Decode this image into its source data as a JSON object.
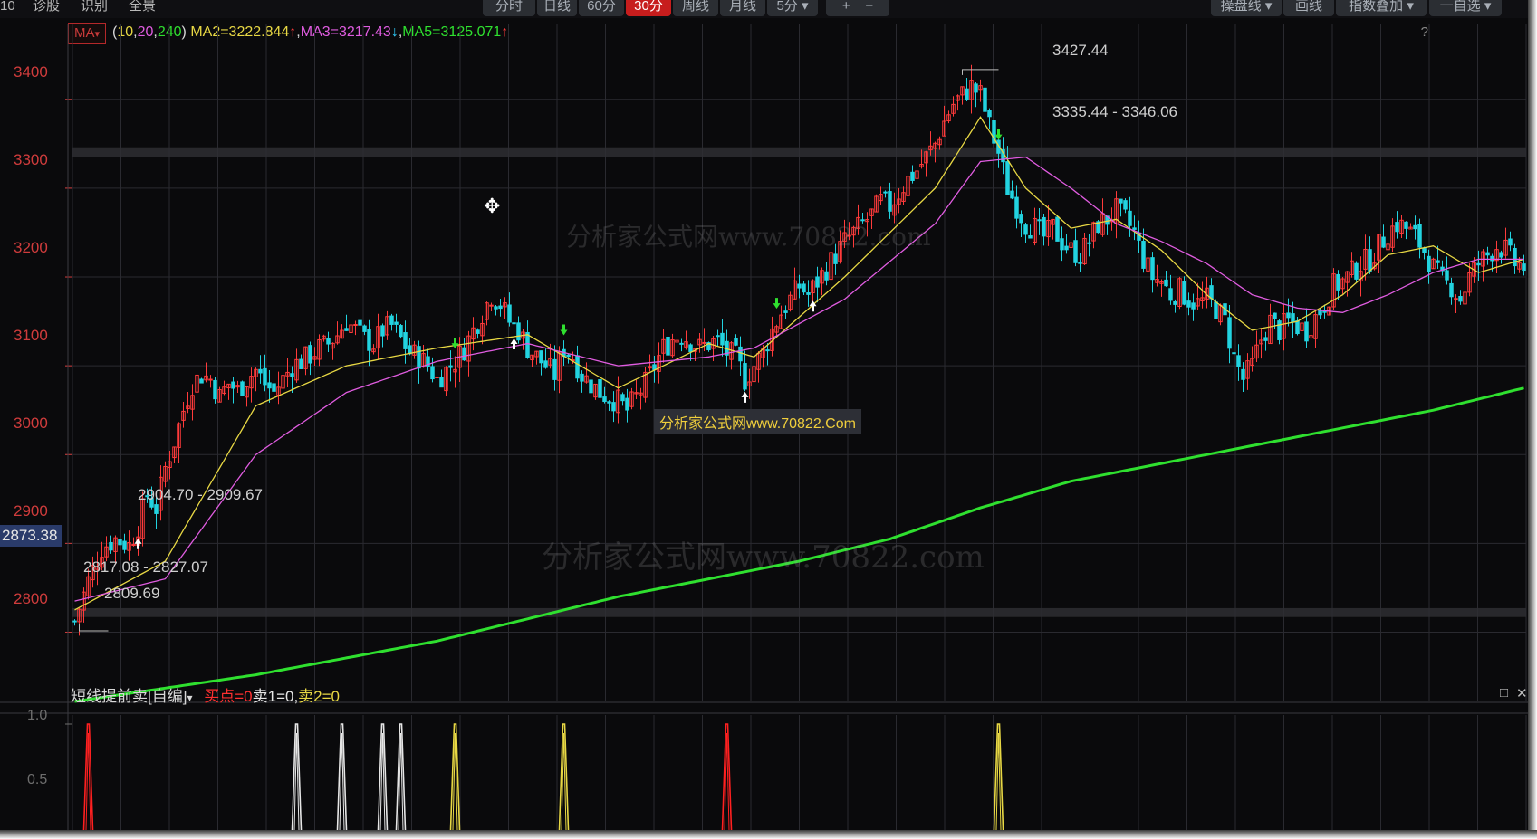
{
  "toolbar": {
    "left_items": [
      "10",
      "诊股",
      "识别",
      "全景"
    ],
    "period_tabs": [
      "分时",
      "日线",
      "60分",
      "30分",
      "周线",
      "月线",
      "5分"
    ],
    "zoom_in": "+",
    "zoom_out": "−",
    "right_items": [
      "操盘线",
      "画线",
      "指数叠加",
      "一自选"
    ]
  },
  "legend": {
    "indicator": "MA",
    "params_open": "(",
    "params": [
      "10",
      "20",
      "240"
    ],
    "params_sep": ",",
    "params_close": ")",
    "ma2": " MA2=3222.844",
    "ma2_arrow": "↑",
    "ma3": "MA3=3217.43",
    "ma3_arrow": "↓",
    "ma5": "MA5=3125.071",
    "ma5_arrow": "↑",
    "sep": ",",
    "help": "?"
  },
  "watermark": {
    "big": "分析家公式网www.70822.com",
    "small": "分析家公式网www.70822.Com"
  },
  "sub_panel": {
    "name": "短线提前卖[自编]",
    "values": [
      "买点=0",
      "卖1=0,",
      "卖2=0"
    ],
    "maximize_icon": "□",
    "close_icon": "✕"
  },
  "colors": {
    "background": "#0a0a0c",
    "up_candle": "#ff3b3b",
    "down_candle": "#22d3e0",
    "ma10": "#e8d844",
    "ma20": "#e05ce0",
    "ma240": "#2fe02f",
    "grid": "#2a2a30",
    "buy_signal": "#ff2020",
    "sell1_signal": "#e6e6e6",
    "sell2_signal": "#e8d844"
  },
  "chart_data": [
    {
      "type": "candlestick",
      "title": "",
      "y_ticks": [
        "3400",
        "3300",
        "3200",
        "3100",
        "3000",
        "2900",
        "2800"
      ],
      "ylim": [
        2722,
        3463
      ],
      "cursor_price": "2873.38",
      "annotations": [
        "3427.44",
        "3335.44 - 3346.06",
        "2904.70 - 2909.67",
        "2817.08 - 2827.07",
        "2809.69"
      ],
      "price_high": 3427.44,
      "price_low": 2809.69,
      "bands": [
        {
          "low": 3335.44,
          "high": 3346.06
        },
        {
          "low": 2817.08,
          "high": 2827.07
        }
      ],
      "close_path": [
        [
          0,
          2812
        ],
        [
          3,
          2858
        ],
        [
          6,
          2895
        ],
        [
          9,
          2905
        ],
        [
          12,
          2898
        ],
        [
          14,
          2920
        ],
        [
          16,
          2955
        ],
        [
          18,
          2940
        ],
        [
          20,
          2985
        ],
        [
          22,
          3015
        ],
        [
          24,
          3050
        ],
        [
          26,
          3080
        ],
        [
          28,
          3090
        ],
        [
          30,
          3085
        ],
        [
          32,
          3065
        ],
        [
          34,
          3080
        ],
        [
          36,
          3072
        ],
        [
          38,
          3085
        ],
        [
          40,
          3095
        ],
        [
          42,
          3080
        ],
        [
          44,
          3070
        ],
        [
          46,
          3085
        ],
        [
          48,
          3100
        ],
        [
          50,
          3105
        ],
        [
          52,
          3112
        ],
        [
          54,
          3120
        ],
        [
          56,
          3125
        ],
        [
          58,
          3135
        ],
        [
          60,
          3150
        ],
        [
          62,
          3140
        ],
        [
          64,
          3130
        ],
        [
          66,
          3125
        ],
        [
          68,
          3140
        ],
        [
          70,
          3145
        ],
        [
          72,
          3130
        ],
        [
          74,
          3115
        ],
        [
          76,
          3110
        ],
        [
          78,
          3100
        ],
        [
          80,
          3085
        ],
        [
          82,
          3095
        ],
        [
          84,
          3105
        ],
        [
          86,
          3120
        ],
        [
          88,
          3140
        ],
        [
          90,
          3160
        ],
        [
          92,
          3180
        ],
        [
          94,
          3170
        ],
        [
          96,
          3150
        ],
        [
          98,
          3140
        ],
        [
          100,
          3120
        ],
        [
          102,
          3110
        ],
        [
          104,
          3100
        ],
        [
          106,
          3090
        ],
        [
          108,
          3120
        ],
        [
          110,
          3110
        ],
        [
          112,
          3090
        ],
        [
          114,
          3080
        ],
        [
          116,
          3070
        ],
        [
          118,
          3065
        ],
        [
          120,
          3060
        ],
        [
          122,
          3050
        ],
        [
          124,
          3065
        ],
        [
          126,
          3080
        ],
        [
          128,
          3100
        ],
        [
          130,
          3120
        ],
        [
          132,
          3130
        ],
        [
          134,
          3135
        ],
        [
          136,
          3128
        ],
        [
          138,
          3120
        ],
        [
          140,
          3125
        ],
        [
          142,
          3128
        ],
        [
          144,
          3115
        ],
        [
          146,
          3110
        ],
        [
          148,
          3085
        ],
        [
          150,
          3100
        ],
        [
          152,
          3115
        ],
        [
          154,
          3140
        ],
        [
          156,
          3160
        ],
        [
          158,
          3175
        ],
        [
          160,
          3190
        ],
        [
          162,
          3180
        ],
        [
          164,
          3195
        ],
        [
          166,
          3210
        ],
        [
          168,
          3225
        ],
        [
          170,
          3240
        ],
        [
          172,
          3250
        ],
        [
          174,
          3260
        ],
        [
          176,
          3270
        ],
        [
          178,
          3285
        ],
        [
          180,
          3280
        ],
        [
          182,
          3295
        ],
        [
          184,
          3310
        ],
        [
          186,
          3320
        ],
        [
          188,
          3335
        ],
        [
          190,
          3350
        ],
        [
          192,
          3375
        ],
        [
          194,
          3395
        ],
        [
          196,
          3405
        ],
        [
          198,
          3415
        ],
        [
          200,
          3405
        ],
        [
          202,
          3370
        ],
        [
          204,
          3340
        ],
        [
          206,
          3300
        ],
        [
          208,
          3280
        ],
        [
          210,
          3260
        ],
        [
          212,
          3255
        ],
        [
          214,
          3245
        ],
        [
          216,
          3255
        ],
        [
          218,
          3240
        ],
        [
          220,
          3230
        ],
        [
          222,
          3225
        ],
        [
          224,
          3240
        ],
        [
          226,
          3260
        ],
        [
          228,
          3265
        ],
        [
          230,
          3275
        ],
        [
          232,
          3265
        ],
        [
          234,
          3250
        ],
        [
          236,
          3220
        ],
        [
          238,
          3200
        ],
        [
          240,
          3195
        ],
        [
          242,
          3180
        ],
        [
          244,
          3185
        ],
        [
          246,
          3175
        ],
        [
          248,
          3170
        ],
        [
          250,
          3175
        ],
        [
          252,
          3165
        ],
        [
          254,
          3150
        ],
        [
          256,
          3110
        ],
        [
          258,
          3085
        ],
        [
          260,
          3100
        ],
        [
          262,
          3130
        ],
        [
          264,
          3150
        ],
        [
          266,
          3140
        ],
        [
          268,
          3150
        ],
        [
          270,
          3145
        ],
        [
          272,
          3140
        ],
        [
          274,
          3155
        ],
        [
          276,
          3170
        ],
        [
          278,
          3190
        ],
        [
          280,
          3195
        ],
        [
          282,
          3205
        ],
        [
          284,
          3215
        ],
        [
          286,
          3220
        ],
        [
          288,
          3235
        ],
        [
          290,
          3250
        ],
        [
          292,
          3260
        ],
        [
          294,
          3255
        ],
        [
          296,
          3245
        ],
        [
          298,
          3230
        ],
        [
          300,
          3210
        ],
        [
          302,
          3195
        ],
        [
          304,
          3190
        ],
        [
          306,
          3175
        ],
        [
          308,
          3200
        ],
        [
          310,
          3215
        ],
        [
          312,
          3225
        ],
        [
          314,
          3235
        ],
        [
          316,
          3230
        ],
        [
          318,
          3215
        ],
        [
          320,
          3212
        ]
      ],
      "total_bars": 321,
      "x_ticks": [],
      "ma_lines": [
        {
          "name": "MA2",
          "values_path": [
            [
              0,
              2825
            ],
            [
              20,
              2880
            ],
            [
              40,
              3055
            ],
            [
              60,
              3100
            ],
            [
              80,
              3120
            ],
            [
              100,
              3135
            ],
            [
              120,
              3075
            ],
            [
              140,
              3125
            ],
            [
              150,
              3110
            ],
            [
              170,
              3200
            ],
            [
              190,
              3300
            ],
            [
              200,
              3380
            ],
            [
              210,
              3300
            ],
            [
              220,
              3255
            ],
            [
              230,
              3265
            ],
            [
              240,
              3230
            ],
            [
              250,
              3180
            ],
            [
              260,
              3140
            ],
            [
              270,
              3150
            ],
            [
              280,
              3180
            ],
            [
              290,
              3225
            ],
            [
              300,
              3235
            ],
            [
              310,
              3205
            ],
            [
              320,
              3220
            ]
          ]
        },
        {
          "name": "MA3",
          "values_path": [
            [
              0,
              2835
            ],
            [
              20,
              2860
            ],
            [
              40,
              3000
            ],
            [
              60,
              3070
            ],
            [
              80,
              3105
            ],
            [
              100,
              3125
            ],
            [
              120,
              3100
            ],
            [
              140,
              3110
            ],
            [
              150,
              3120
            ],
            [
              170,
              3175
            ],
            [
              190,
              3260
            ],
            [
              200,
              3330
            ],
            [
              210,
              3335
            ],
            [
              220,
              3300
            ],
            [
              230,
              3260
            ],
            [
              240,
              3240
            ],
            [
              250,
              3215
            ],
            [
              260,
              3180
            ],
            [
              270,
              3165
            ],
            [
              280,
              3160
            ],
            [
              290,
              3180
            ],
            [
              300,
              3205
            ],
            [
              310,
              3220
            ],
            [
              320,
              3220
            ]
          ]
        },
        {
          "name": "MA5",
          "values_path": [
            [
              0,
              2722
            ],
            [
              40,
              2752
            ],
            [
              80,
              2790
            ],
            [
              120,
              2840
            ],
            [
              160,
              2880
            ],
            [
              180,
              2905
            ],
            [
              200,
              2940
            ],
            [
              220,
              2970
            ],
            [
              240,
              2990
            ],
            [
              260,
              3010
            ],
            [
              280,
              3030
            ],
            [
              300,
              3050
            ],
            [
              320,
              3075
            ]
          ]
        }
      ],
      "signals": [
        {
          "type": "buy",
          "bar": 14
        },
        {
          "type": "buy",
          "bar": 97
        },
        {
          "type": "buy",
          "bar": 148
        },
        {
          "type": "buy",
          "bar": 163
        },
        {
          "type": "sell",
          "bar": 84
        },
        {
          "type": "sell",
          "bar": 108
        },
        {
          "type": "sell",
          "bar": 155
        },
        {
          "type": "sell",
          "bar": 204
        }
      ]
    },
    {
      "type": "bar",
      "title": "短线提前卖[自编]",
      "y_ticks": [
        "1.0",
        "0.5"
      ],
      "ylim": [
        0,
        1
      ],
      "series": [
        {
          "name": "买点",
          "bars": [
            3,
            144
          ]
        },
        {
          "name": "卖1",
          "bars": [
            49,
            59,
            68,
            72
          ]
        },
        {
          "name": "卖2",
          "bars": [
            84,
            108,
            204
          ]
        }
      ]
    }
  ]
}
